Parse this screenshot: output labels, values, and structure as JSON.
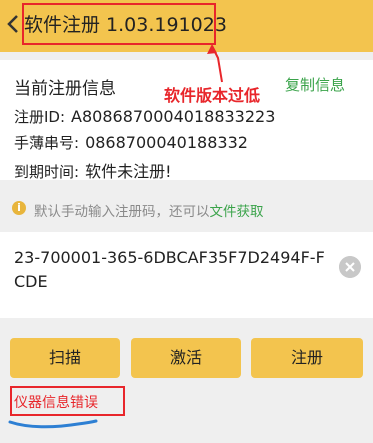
{
  "header": {
    "title": "软件注册 1.03.191023"
  },
  "info": {
    "heading": "当前注册信息",
    "copy_label": "复制信息",
    "annotation": "软件版本过低",
    "rows": [
      {
        "label": "注册ID:",
        "value": "A808687000401883322З"
      },
      {
        "label": "手薄串号:",
        "value": "0868700040188332"
      },
      {
        "label": "到期时间:",
        "value": "软件未注册!"
      }
    ]
  },
  "hint": {
    "text": "默认手动输入注册码，还可以",
    "link": "文件获取"
  },
  "code": {
    "value": "23-700001-365-6DBCAF35F7D2494F-FCDE"
  },
  "buttons": {
    "scan": "扫描",
    "activate": "激活",
    "register": "注册"
  },
  "error": {
    "text": "仪器信息错误"
  },
  "colors": {
    "header": "#f3c44e",
    "accent_green": "#3aa34a",
    "annotation_red": "#e8262b"
  }
}
